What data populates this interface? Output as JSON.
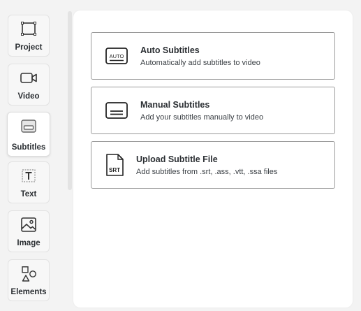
{
  "sidebar": {
    "items": [
      {
        "label": "Project",
        "icon": "crop-frame-icon"
      },
      {
        "label": "Video",
        "icon": "video-camera-icon"
      },
      {
        "label": "Subtitles",
        "icon": "subtitles-icon",
        "active": true
      },
      {
        "label": "Text",
        "icon": "text-box-icon"
      },
      {
        "label": "Image",
        "icon": "image-icon"
      },
      {
        "label": "Elements",
        "icon": "shapes-icon"
      }
    ]
  },
  "panel": {
    "options": [
      {
        "title": "Auto Subtitles",
        "description": "Automatically add subtitles to video",
        "icon": "auto-subtitles-icon",
        "icon_text": "AUTO"
      },
      {
        "title": "Manual Subtitles",
        "description": "Add your subtitles manually to video",
        "icon": "manual-subtitles-icon"
      },
      {
        "title": "Upload Subtitle File",
        "description": "Add subtitles from .srt, .ass, .vtt, .ssa files",
        "icon": "srt-file-icon",
        "icon_text": "SRT"
      }
    ]
  },
  "colors": {
    "background": "#f3f3f3",
    "panel": "#ffffff",
    "border": "#9a9a9a",
    "text": "#2b2f33"
  }
}
